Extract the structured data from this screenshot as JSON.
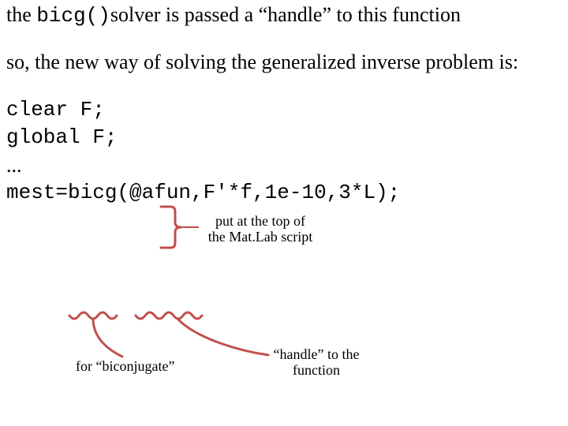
{
  "para1": {
    "pre": "the ",
    "code": "bicg()",
    "post": "solver is passed a “handle” to this function"
  },
  "para2": "so, the new way of solving the generalized inverse problem is:",
  "code": {
    "line1": "clear F;",
    "line2": "global F;",
    "line3": "...",
    "line4": "mest=bicg(@afun,F'*f,1e-10,3*L);"
  },
  "annotations": {
    "top_label_l1": "put at the top of",
    "top_label_l2": "the Mat.Lab script",
    "biconjugate": "for “biconjugate”",
    "handle_l1": "“handle” to the",
    "handle_l2": "function"
  }
}
